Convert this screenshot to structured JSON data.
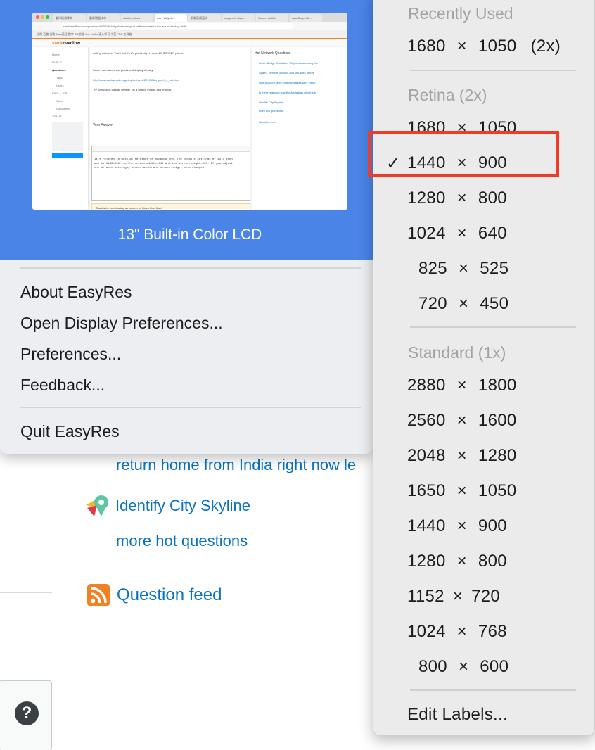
{
  "background_page": {
    "hot_network_questions": [
      {
        "label": "return home from India right now le"
      },
      {
        "label": "Identify City Skyline"
      }
    ],
    "more_hot_questions": "more hot questions",
    "question_feed": "Question feed",
    "help_glyph": "?"
  },
  "easyres_panel": {
    "display_name": "13\" Built-in Color LCD",
    "menu": {
      "about": "About EasyRes",
      "open_display_prefs": "Open Display Preferences...",
      "preferences": "Preferences...",
      "feedback": "Feedback...",
      "quit": "Quit EasyRes"
    },
    "preview": {
      "tabs": [
        "翻译精调译本",
        "最新增强技术",
        "stackoverflow",
        "css - Why do...",
        "前端高频面试",
        "css pixels disp...",
        "Screen widths",
        "JavaScript Wi..."
      ],
      "url": "stackoverflow.com/questions/9697136/why-does-viewport-width-not-match-the-actual-display-width",
      "bookmarks": "应用  百度  谷歌  Java面经  数字  JS/前端  Vue  Kotlin  读入学习  书签  PDF  工具箱",
      "logo_pre": "stack",
      "logo_post": "overflow",
      "nav": [
        "Home",
        "PUBLIC",
        "Questions",
        "Tags",
        "Users",
        "FIND A JOB",
        "Jobs",
        "Companies",
        "TEAMS"
      ],
      "main_lines": [
        "editing software. You'll find it's 2X pixels big - I mean 2X SCREEN pixels.",
        "Some more about css pixels and display density:",
        "http://www.quirksmode.org/blog/archives/2010/04/a_pixel_is_not.html",
        "Try \"css pixels display density\" on a search engine and enjoy it.",
        "Your Answer",
        "It's related to display settings of macbook pro. The default settings of 13.3 inch",
        "mbp is 1440x900, so the screen.width=1440 and the screen.height=900. If you adjust",
        "the default settings, screen.width and screen.height also changed",
        "Thanks for contributing an answer to Stack Overflow!"
      ],
      "side_lines": [
        "Hot Network Questions",
        "When Bridge Oscillator: Why does squaring the",
        "Spam - remove obvious and low-lines before",
        "One should I send chat messages with \"hello\"",
        "Is there really no way the Australian citizens to",
        "Identify City Skyline",
        "more hot questions",
        "Question feed"
      ]
    }
  },
  "resolution_menu": {
    "sections": [
      {
        "title": "Recently Used",
        "items": [
          {
            "w": "1680",
            "h": "1050",
            "suffix": "(2x)",
            "checked": false
          }
        ]
      },
      {
        "title": "Retina (2x)",
        "items": [
          {
            "w": "1680",
            "h": "1050",
            "checked": false
          },
          {
            "w": "1440",
            "h": "900",
            "checked": true
          },
          {
            "w": "1280",
            "h": "800",
            "checked": false
          },
          {
            "w": "1024",
            "h": "640",
            "checked": false
          },
          {
            "w": "825",
            "h": "525",
            "checked": false
          },
          {
            "w": "720",
            "h": "450",
            "checked": false
          }
        ]
      },
      {
        "title": "Standard (1x)",
        "items": [
          {
            "w": "2880",
            "h": "1800",
            "checked": false
          },
          {
            "w": "2560",
            "h": "1600",
            "checked": false
          },
          {
            "w": "2048",
            "h": "1280",
            "checked": false
          },
          {
            "w": "1650",
            "h": "1050",
            "checked": false
          },
          {
            "w": "1440",
            "h": "900",
            "checked": false
          },
          {
            "w": "1280",
            "h": "800",
            "checked": false
          },
          {
            "w": "1152",
            "h": "720",
            "checked": false
          },
          {
            "w": "1024",
            "h": "768",
            "checked": false
          },
          {
            "w": "800",
            "h": "600",
            "checked": false
          }
        ]
      }
    ],
    "times_glyph": "×",
    "check_glyph": "✓",
    "edit_labels": "Edit Labels...",
    "highlight_color": "#f23b27"
  },
  "colors": {
    "panel_header": "#4a84e6",
    "link": "#0a73c1",
    "rss": "#f48024"
  }
}
